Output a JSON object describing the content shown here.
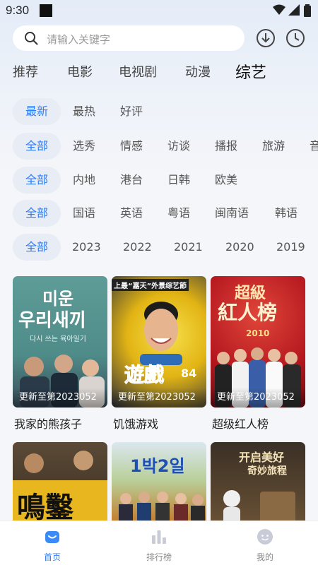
{
  "status_bar": {
    "time": "9:30"
  },
  "search": {
    "placeholder": "请输入关键字"
  },
  "channel_tabs": [
    "推荐",
    "电影",
    "电视剧",
    "动漫",
    "综艺"
  ],
  "active_tab_index": 4,
  "filters": {
    "sort": [
      "最新",
      "最热",
      "好评"
    ],
    "type": [
      "全部",
      "选秀",
      "情感",
      "访谈",
      "播报",
      "旅游",
      "音"
    ],
    "region": [
      "全部",
      "内地",
      "港台",
      "日韩",
      "欧美"
    ],
    "language": [
      "全部",
      "国语",
      "英语",
      "粤语",
      "闽南语",
      "韩语"
    ],
    "year": [
      "全部",
      "2023",
      "2022",
      "2021",
      "2020",
      "2019"
    ]
  },
  "cards": [
    {
      "title": "我家的熊孩子",
      "badge": "更新至第2023052",
      "poster_text": [
        "미운",
        "우리새끼",
        "다시 쓰는 육아일기"
      ]
    },
    {
      "title": "饥饿游戏",
      "badge": "更新至第2023052",
      "poster_text": [
        "上最“嘉天”外景综艺節",
        "遊戲",
        "84"
      ]
    },
    {
      "title": "超级红人榜",
      "badge": "更新至第2023052",
      "poster_text": [
        "超級",
        "紅人榜",
        "2010"
      ]
    },
    {
      "title": "",
      "badge": "",
      "poster_text": [
        "鳴鑿"
      ]
    },
    {
      "title": "",
      "badge": "",
      "poster_text": [
        "1박2일"
      ]
    },
    {
      "title": "",
      "badge": "",
      "poster_text": [
        "开启美好",
        "奇妙旅程"
      ]
    }
  ],
  "bottom_nav": [
    {
      "label": "首页",
      "icon": "home-icon",
      "active": true
    },
    {
      "label": "排行榜",
      "icon": "ranking-icon",
      "active": false
    },
    {
      "label": "我的",
      "icon": "profile-icon",
      "active": false
    }
  ],
  "colors": {
    "accent": "#2f7cf6",
    "chip_selected_bg": "#e7ecf5"
  }
}
